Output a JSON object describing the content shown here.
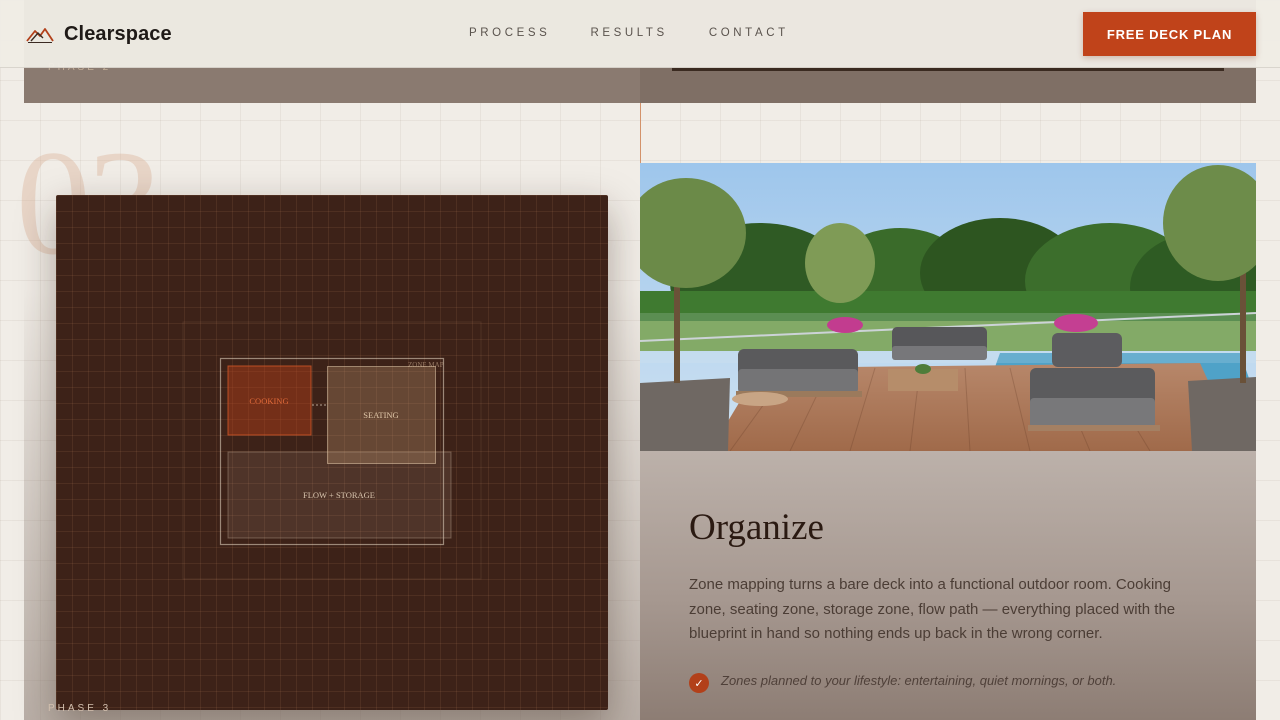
{
  "brand": {
    "name": "Clearspace",
    "logo_icon": "mountain-logo-icon"
  },
  "nav": {
    "items": [
      {
        "label": "PROCESS"
      },
      {
        "label": "RESULTS"
      },
      {
        "label": "CONTACT"
      }
    ]
  },
  "cta": {
    "label": "FREE DECK PLAN"
  },
  "hero_top": {
    "phase_label": "PHASE 2"
  },
  "step": {
    "number": "03",
    "phase_label": "PHASE 3"
  },
  "plan": {
    "corner_label": "ZONE MAP",
    "zones": [
      {
        "label": "COOKING"
      },
      {
        "label": "SEATING"
      },
      {
        "label": "FLOW + STORAGE"
      }
    ]
  },
  "content": {
    "title": "Organize",
    "description": "Zone mapping turns a bare deck into a functional outdoor room. Cooking zone, seating zone, storage zone, flow path — everything placed with the blueprint in hand so nothing ends up back in the wrong corner.",
    "bullets": [
      {
        "text": "Zones planned to your lifestyle: entertaining, quiet mornings, or both.",
        "icon": "check-icon"
      }
    ]
  },
  "colors": {
    "accent": "#c0431a",
    "plan_bg": "#3d2218",
    "cooking_zone": "#c0431a"
  }
}
